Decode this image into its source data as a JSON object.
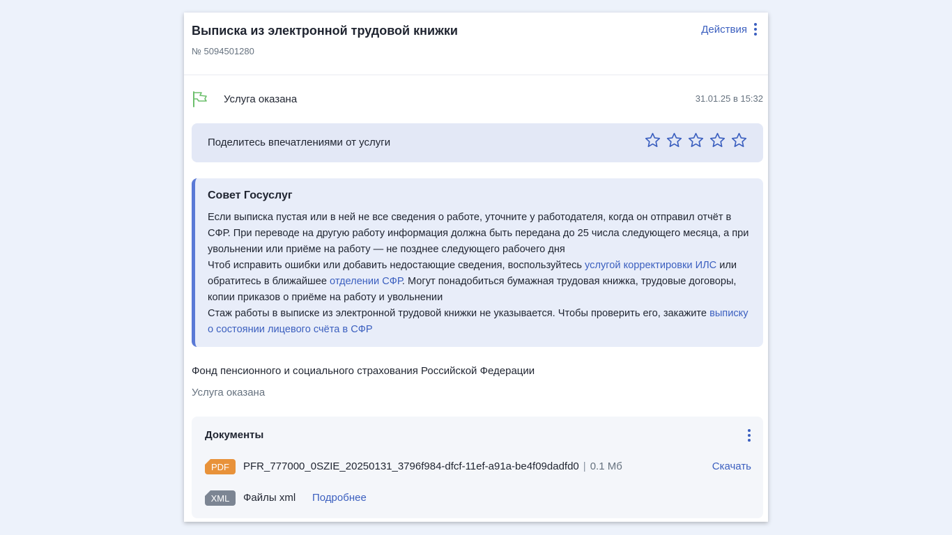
{
  "header": {
    "title": "Выписка из электронной трудовой книжки",
    "order_number": "№ 5094501280",
    "actions_label": "Действия"
  },
  "status": {
    "label": "Услуга оказана",
    "timestamp": "31.01.25 в 15:32",
    "flag_icon": "flag-icon",
    "flag_color": "#6cbf6c"
  },
  "feedback": {
    "prompt": "Поделитесь впечатлениями от услуги",
    "rating_max": 5,
    "rating_value": 0
  },
  "tip": {
    "title": "Совет Госуслуг",
    "p1": "Если выписка пустая или в ней не все сведения о работе, уточните у работодателя, когда он отправил отчёт в СФР. При переводе на другую работу информация должна быть передана до 25 числа следующего месяца, а при увольнении или приёме на работу — не позднее следующего рабочего дня",
    "p2_before": "Чтоб исправить ошибки или добавить недостающие сведения, воспользуйтесь ",
    "p2_link1": "услугой корректировки ИЛС",
    "p2_middle": " или обратитесь в ближайшее ",
    "p2_link2": "отделении СФР",
    "p2_after": ". Могут понадобиться бумажная трудовая книжка, трудовые договоры, копии приказов о приёме на работу и увольнении",
    "p3_before": "Стаж работы в выписке из электронной трудовой книжки не указывается. Чтобы проверить его, закажите ",
    "p3_link": "выписку о состоянии лицевого счёта в СФР"
  },
  "organization": {
    "name": "Фонд пенсионного и социального страхования Российской Федерации",
    "status": "Услуга оказана"
  },
  "documents": {
    "title": "Документы",
    "files": [
      {
        "type": "PDF",
        "name": "PFR_777000_0SZIE_20250131_3796f984-dfcf-11ef-a91a-be4f09dadfd0",
        "separator": "|",
        "size": "0.1 Мб",
        "action": "Скачать"
      }
    ],
    "xml": {
      "type": "XML",
      "label": "Файлы xml",
      "more": "Подробнее"
    }
  },
  "colors": {
    "accent": "#3b5fbf",
    "tip_border": "#5a79d6",
    "pdf_badge": "#e8923a",
    "xml_badge": "#7c8593"
  }
}
